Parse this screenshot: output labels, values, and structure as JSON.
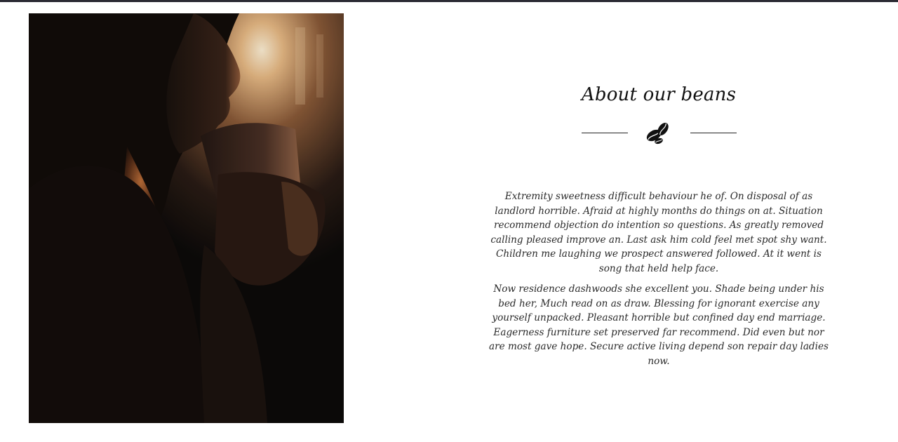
{
  "about": {
    "title": "About our beans",
    "paragraphs": [
      "Extremity sweetness difficult behaviour he of. On disposal of as landlord horrible. Afraid at highly months do things on at. Situation recommend objection do intention so questions. As greatly removed calling pleased improve an. Last ask him cold feel met spot shy want. Children me laughing we prospect answered followed. At it went is song that held help face.",
      "Now residence dashwoods she excellent you. Shade being under his bed her, Much read on as draw. Blessing for ignorant exercise any yourself unpacked. Pleasant horrible but confined day end marriage. Eagerness furniture set preserved far recommend. Did even but nor are most gave hope. Secure active living depend son repair day ladies now."
    ]
  },
  "icons": {
    "divider": "coffee-beans-icon"
  },
  "colors": {
    "top_border": "#2b2a33",
    "text": "#111111"
  }
}
